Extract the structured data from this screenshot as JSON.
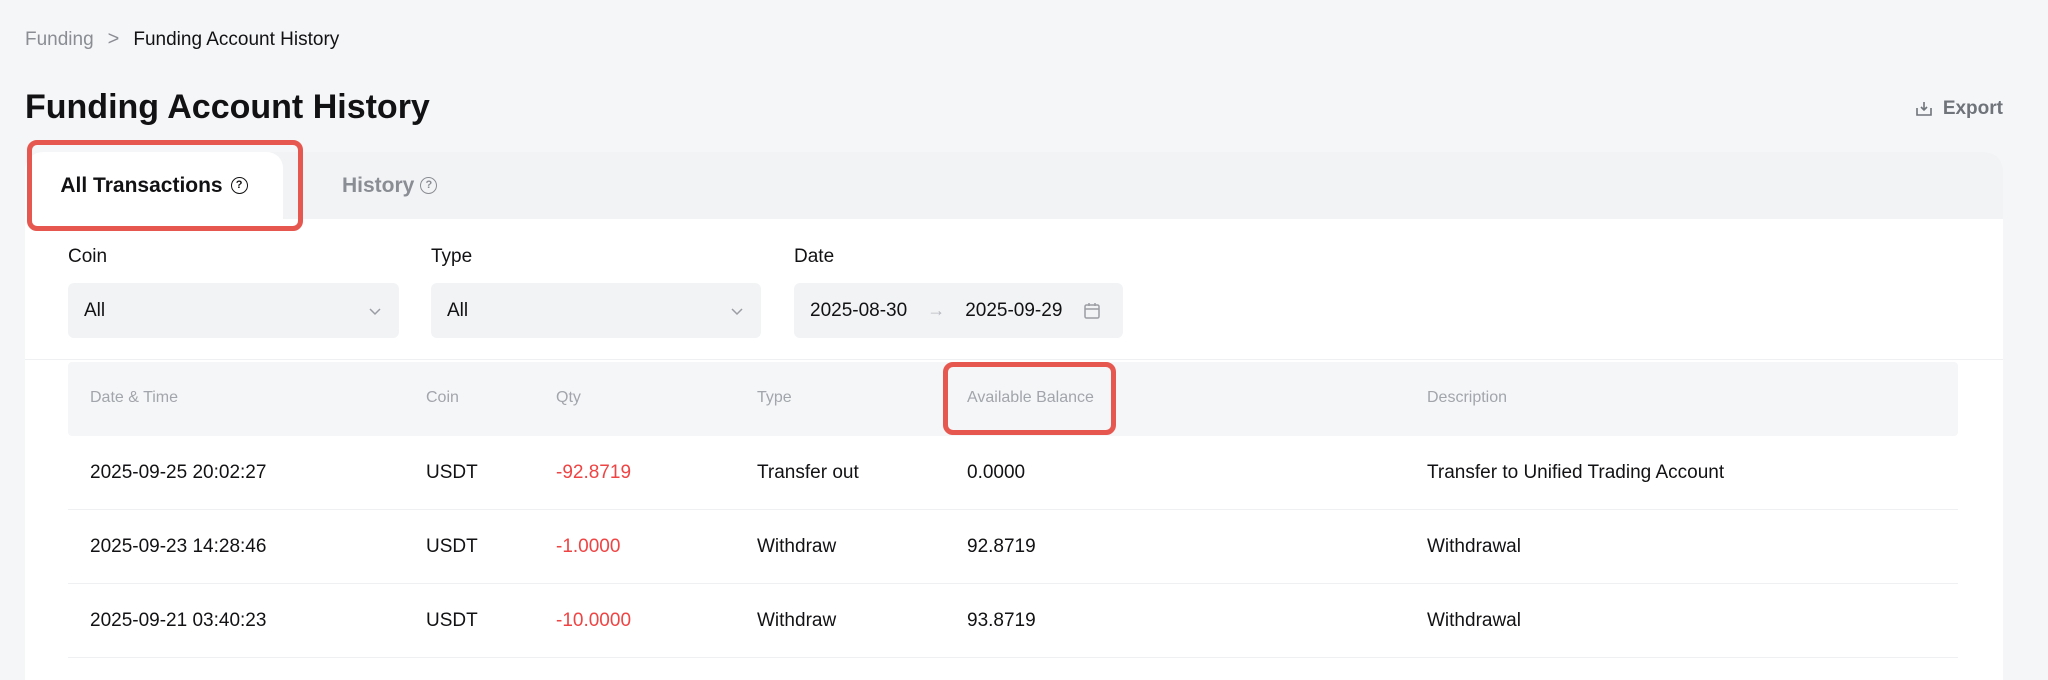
{
  "breadcrumb": {
    "parent": "Funding",
    "separator": ">",
    "current": "Funding Account History"
  },
  "page": {
    "title": "Funding Account History",
    "export_label": "Export"
  },
  "tabs": [
    {
      "label": "All Transactions",
      "active": true
    },
    {
      "label": "History",
      "active": false
    }
  ],
  "filters": {
    "coin": {
      "label": "Coin",
      "value": "All"
    },
    "type": {
      "label": "Type",
      "value": "All"
    },
    "date": {
      "label": "Date",
      "start": "2025-08-30",
      "end": "2025-09-29"
    }
  },
  "table": {
    "columns": [
      "Date & Time",
      "Coin",
      "Qty",
      "Type",
      "Available Balance",
      "Description"
    ],
    "rows": [
      {
        "datetime": "2025-09-25 20:02:27",
        "coin": "USDT",
        "qty": "-92.8719",
        "type": "Transfer out",
        "balance": "0.0000",
        "description": "Transfer to Unified Trading Account"
      },
      {
        "datetime": "2025-09-23 14:28:46",
        "coin": "USDT",
        "qty": "-1.0000",
        "type": "Withdraw",
        "balance": "92.8719",
        "description": "Withdrawal"
      },
      {
        "datetime": "2025-09-21 03:40:23",
        "coin": "USDT",
        "qty": "-10.0000",
        "type": "Withdraw",
        "balance": "93.8719",
        "description": "Withdrawal"
      }
    ]
  },
  "colors": {
    "negative": "#ef4444",
    "highlight": "#e6574f",
    "background": "#f5f6f8"
  }
}
